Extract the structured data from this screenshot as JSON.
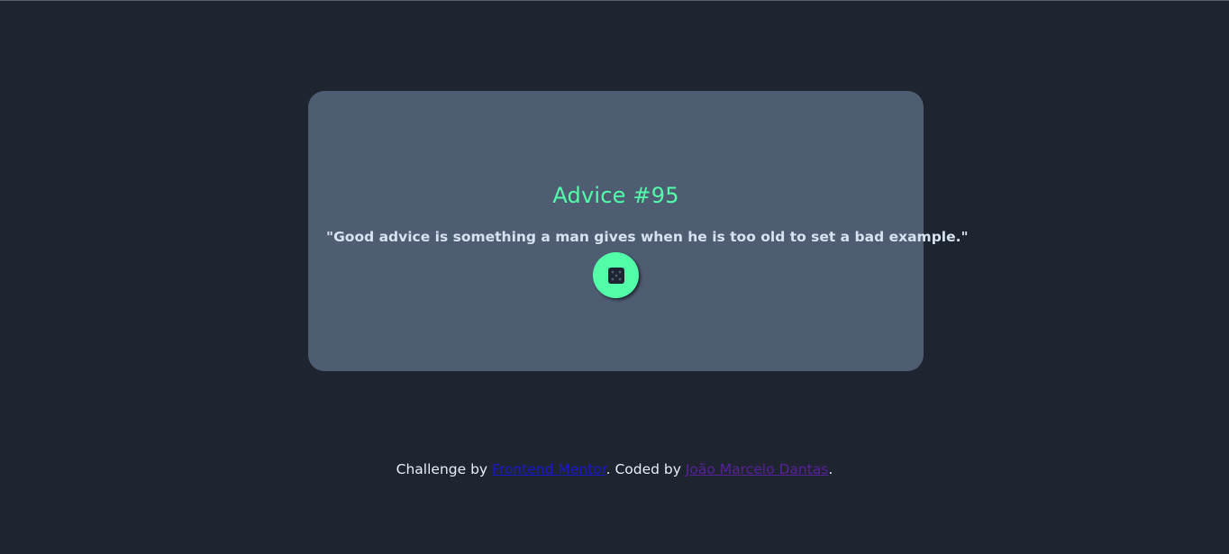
{
  "advice": {
    "title": "Advice #95",
    "quote": "\"Good advice is something a man gives when he is too old to set a bad example.\"",
    "button_icon": "dice-icon"
  },
  "footer": {
    "prefix": "Challenge by ",
    "challenge_link": "Frontend Mentor",
    "middle": ". Coded by ",
    "author_link": "João Marcelo Dantas",
    "suffix": "."
  },
  "colors": {
    "background": "#1f2431",
    "card": "#4f5d73",
    "accent": "#52ffa8",
    "quote_text": "#d6e2f0",
    "link": "#1a1acd",
    "visited_link": "#59209b"
  }
}
